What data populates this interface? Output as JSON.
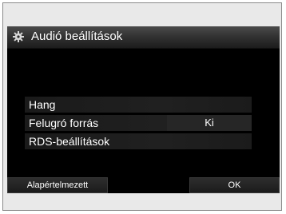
{
  "window": {
    "title": "Audió beállítások",
    "title_icon": "settings-gear-icon"
  },
  "menu": {
    "items": [
      {
        "label": "Hang",
        "value": ""
      },
      {
        "label": "Felugró forrás",
        "value": "Ki"
      },
      {
        "label": "RDS-beállítások",
        "value": ""
      }
    ]
  },
  "footer": {
    "default_label": "Alapértelmezett",
    "ok_label": "OK"
  },
  "colors": {
    "screen_background": "#000000",
    "text": "#ffffff",
    "frame": "#e9e9e9"
  }
}
